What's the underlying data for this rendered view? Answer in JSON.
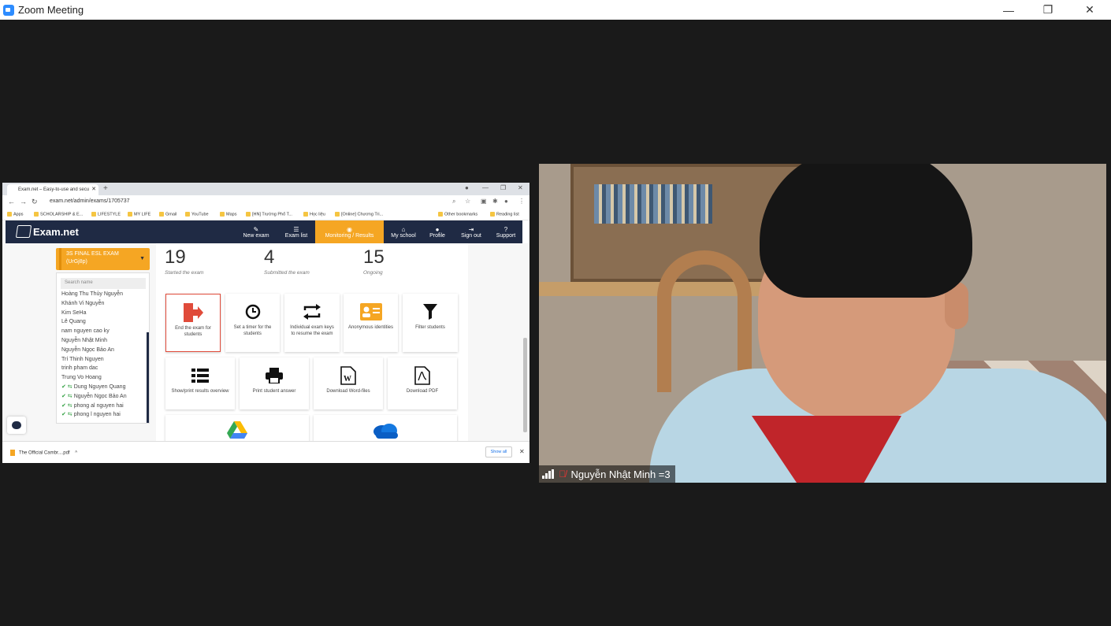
{
  "window": {
    "title": "Zoom Meeting",
    "controls": [
      "—",
      "❐",
      "✕"
    ]
  },
  "browser": {
    "tab_title": "Exam.net – Easy-to-use and secu",
    "url": "exam.net/admin/exams/1705737",
    "bookmarks": [
      "Apps",
      "SCHOLARSHIP & E...",
      "LIFESTYLE",
      "MY LIFE",
      "Gmail",
      "YouTube",
      "Maps",
      "[HN] Trường Phổ T...",
      "Học liệu",
      "[Online] Chương Tri...",
      "Other bookmarks",
      "Reading list"
    ],
    "download_file": "The Official Cambr....pdf",
    "show_all": "Show all"
  },
  "exam_app": {
    "logo": "Exam.net",
    "nav": [
      {
        "icon": "✎",
        "label": "New exam"
      },
      {
        "icon": "☰",
        "label": "Exam list"
      },
      {
        "icon": "◉",
        "label": "Monitoring / Results"
      },
      {
        "icon": "⌂",
        "label": "My school"
      },
      {
        "icon": "●",
        "label": "Profile"
      },
      {
        "icon": "⇥",
        "label": "Sign out"
      },
      {
        "icon": "?",
        "label": "Support"
      }
    ],
    "exam_select": {
      "line1": "3S FINAL ESL EXAM",
      "line2": "(UrGj8p)"
    },
    "search_placeholder": "Search name",
    "students": [
      {
        "name": "Hoàng Thu Thủy Nguyễn",
        "done": false
      },
      {
        "name": "Khánh Vi Nguyễn",
        "done": false
      },
      {
        "name": "Kim SeHa",
        "done": false
      },
      {
        "name": "Lê Quang",
        "done": false
      },
      {
        "name": "nam nguyen cao ky",
        "done": false
      },
      {
        "name": "Nguyễn Nhật Minh",
        "done": false
      },
      {
        "name": "Nguyễn Ngọc Bảo An",
        "done": false
      },
      {
        "name": "Trí Thinh Nguyen",
        "done": false
      },
      {
        "name": "trinh pham dac",
        "done": false
      },
      {
        "name": "Trung Vo Hoang",
        "done": false
      },
      {
        "name": "Dung Nguyen Quang",
        "done": true
      },
      {
        "name": "Nguyễn Ngọc Bảo An",
        "done": true
      },
      {
        "name": "phong al nguyen hai",
        "done": true
      },
      {
        "name": "phong l nguyen hai",
        "done": true
      }
    ],
    "stats": [
      {
        "value": "19",
        "label": "Started the exam"
      },
      {
        "value": "4",
        "label": "Submitted the exam"
      },
      {
        "value": "15",
        "label": "Ongoing"
      }
    ],
    "actions_row1": [
      {
        "label": "End the exam for students",
        "icon": "exit-icon"
      },
      {
        "label": "Set a timer for the students",
        "icon": "clock-icon"
      },
      {
        "label": "Individual exam keys to resume the exam",
        "icon": "repeat-icon"
      },
      {
        "label": "Anonymous identities",
        "icon": "id-card-icon"
      },
      {
        "label": "Filter students",
        "icon": "filter-icon"
      }
    ],
    "actions_row2": [
      {
        "label": "Show/print results overview",
        "icon": "table-icon"
      },
      {
        "label": "Print student answer",
        "icon": "printer-icon"
      },
      {
        "label": "Download Word-files",
        "icon": "word-icon"
      },
      {
        "label": "Download PDF",
        "icon": "pdf-icon"
      }
    ],
    "accent_color": "#f5a623",
    "nav_color": "#1f2a44",
    "danger_color": "#e04b3a"
  },
  "participant": {
    "name": "Nguyễn Nhật Minh =3"
  }
}
